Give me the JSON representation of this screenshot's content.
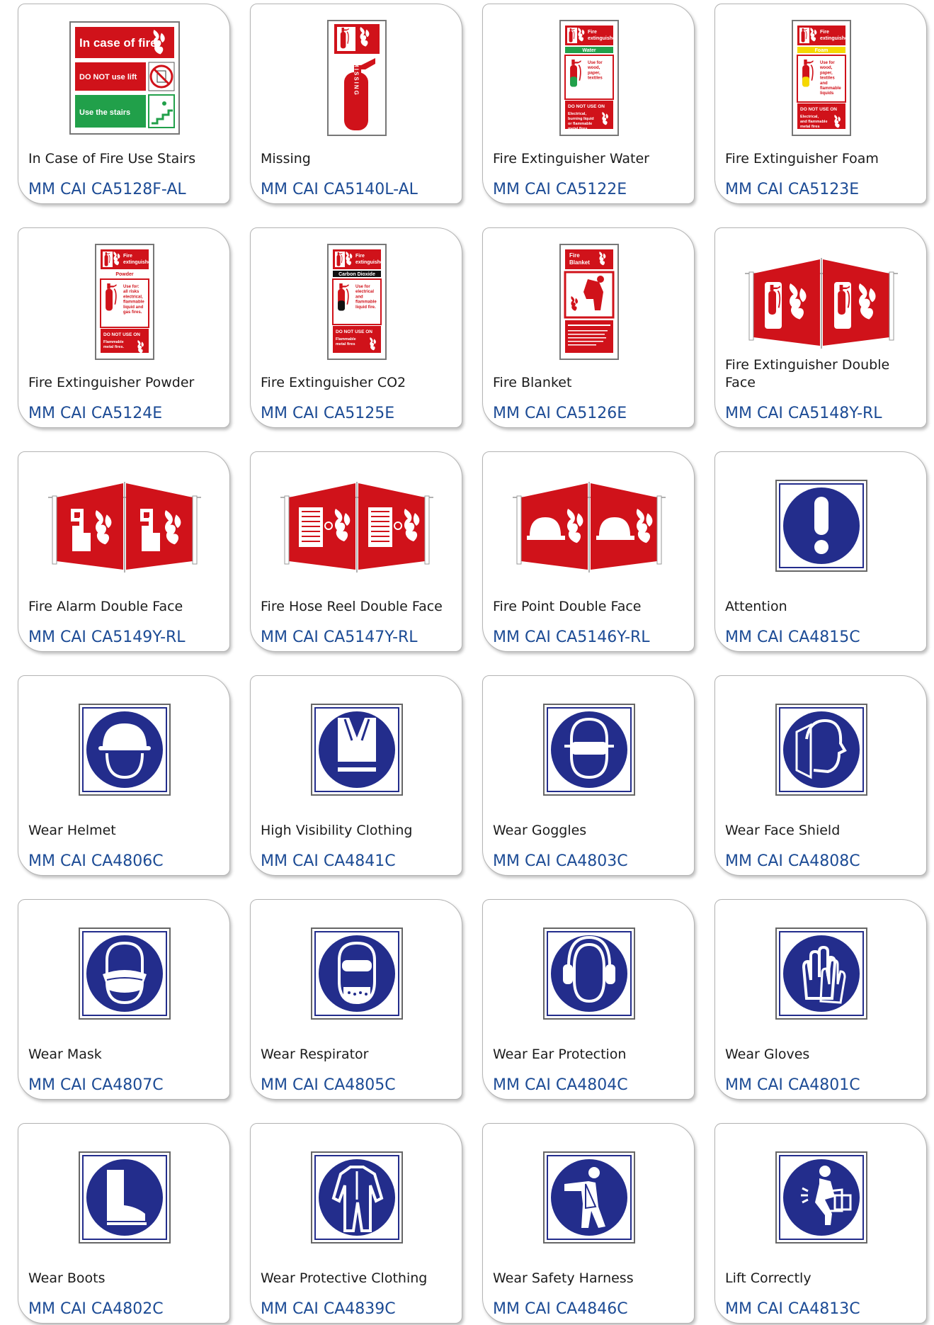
{
  "colors": {
    "fire_red": "#d0121a",
    "mandatory_blue": "#232d8c",
    "code_blue": "#1c4b95",
    "exit_green": "#21a04a"
  },
  "products": [
    {
      "name": "In Case of Fire Use Stairs",
      "code": "MM CAI CA5128F-AL",
      "icon": "fire-use-stairs-sign-icon",
      "texts": [
        "In case of fire",
        "DO NOT use lift",
        "Use the stairs"
      ]
    },
    {
      "name": "Missing",
      "code": "MM CAI CA5140L-AL",
      "icon": "missing-extinguisher-sign-icon",
      "texts": [
        "MISSING"
      ]
    },
    {
      "name": "Fire Extinguisher Water",
      "code": "MM CAI CA5122E",
      "icon": "water-extinguisher-sign-icon",
      "texts": [
        "Fire",
        "extinguisher",
        "Water",
        "Use for",
        "wood,",
        "paper,",
        "textiles",
        "DO NOT USE ON",
        "Electrical,",
        "burning liquid",
        "or flammable",
        "metal fires"
      ]
    },
    {
      "name": "Fire Extinguisher Foam",
      "code": "MM CAI CA5123E",
      "icon": "foam-extinguisher-sign-icon",
      "texts": [
        "Fire",
        "extinguisher",
        "Foam",
        "Use for",
        "wood,",
        "paper,",
        "textiles",
        "and",
        "flammable",
        "liquids",
        "DO NOT USE ON",
        "Electrical,",
        "and flammable",
        "metal fires"
      ]
    },
    {
      "name": "Fire Extinguisher Powder",
      "code": "MM CAI CA5124E",
      "icon": "powder-extinguisher-sign-icon",
      "texts": [
        "Fire",
        "extinguisher",
        "Powder",
        "Use for:",
        "all risks",
        "electrical,",
        "flammable",
        "liquid and",
        "gas fires.",
        "DO NOT USE ON",
        "Flammable",
        "metal fires."
      ]
    },
    {
      "name": "Fire Extinguisher CO2",
      "code": "MM CAI CA5125E",
      "icon": "co2-extinguisher-sign-icon",
      "texts": [
        "Fire",
        "extinguisher",
        "Carbon Dioxide",
        "Use for",
        "electrical",
        "and",
        "flammable",
        "liquid fire.",
        "DO NOT USE ON",
        "Flammable",
        "metal fires"
      ]
    },
    {
      "name": "Fire Blanket",
      "code": "MM CAI CA5126E",
      "icon": "fire-blanket-sign-icon",
      "texts": [
        "Fire",
        "Blanket"
      ]
    },
    {
      "name": "Fire Extinguisher Double Face",
      "code": "MM CAI CA5148Y-RL",
      "icon": "extinguisher-double-face-sign-icon",
      "texts": []
    },
    {
      "name": "Fire Alarm Double Face",
      "code": "MM CAI CA5149Y-RL",
      "icon": "fire-alarm-double-face-sign-icon",
      "texts": []
    },
    {
      "name": "Fire Hose Reel Double Face",
      "code": "MM CAI CA5147Y-RL",
      "icon": "hose-reel-double-face-sign-icon",
      "texts": []
    },
    {
      "name": "Fire Point Double Face",
      "code": "MM CAI CA5146Y-RL",
      "icon": "fire-point-double-face-sign-icon",
      "texts": []
    },
    {
      "name": "Attention",
      "code": "MM CAI CA4815C",
      "icon": "attention-exclamation-icon",
      "texts": []
    },
    {
      "name": "Wear Helmet",
      "code": "MM CAI CA4806C",
      "icon": "wear-helmet-icon",
      "texts": []
    },
    {
      "name": "High Visibility Clothing",
      "code": "MM CAI CA4841C",
      "icon": "high-visibility-vest-icon",
      "texts": []
    },
    {
      "name": "Wear Goggles",
      "code": "MM CAI CA4803C",
      "icon": "wear-goggles-icon",
      "texts": []
    },
    {
      "name": "Wear Face Shield",
      "code": "MM CAI CA4808C",
      "icon": "wear-face-shield-icon",
      "texts": []
    },
    {
      "name": "Wear Mask",
      "code": "MM CAI CA4807C",
      "icon": "wear-mask-icon",
      "texts": []
    },
    {
      "name": "Wear Respirator",
      "code": "MM CAI CA4805C",
      "icon": "wear-respirator-icon",
      "texts": []
    },
    {
      "name": "Wear Ear Protection",
      "code": "MM CAI CA4804C",
      "icon": "wear-ear-protection-icon",
      "texts": []
    },
    {
      "name": "Wear Gloves",
      "code": "MM CAI CA4801C",
      "icon": "wear-gloves-icon",
      "texts": []
    },
    {
      "name": "Wear Boots",
      "code": "MM CAI CA4802C",
      "icon": "wear-boots-icon",
      "texts": []
    },
    {
      "name": "Wear Protective Clothing",
      "code": "MM CAI CA4839C",
      "icon": "wear-protective-clothing-icon",
      "texts": []
    },
    {
      "name": "Wear Safety Harness",
      "code": "MM CAI CA4846C",
      "icon": "wear-safety-harness-icon",
      "texts": []
    },
    {
      "name": "Lift Correctly",
      "code": "MM CAI CA4813C",
      "icon": "lift-correctly-icon",
      "texts": []
    }
  ]
}
